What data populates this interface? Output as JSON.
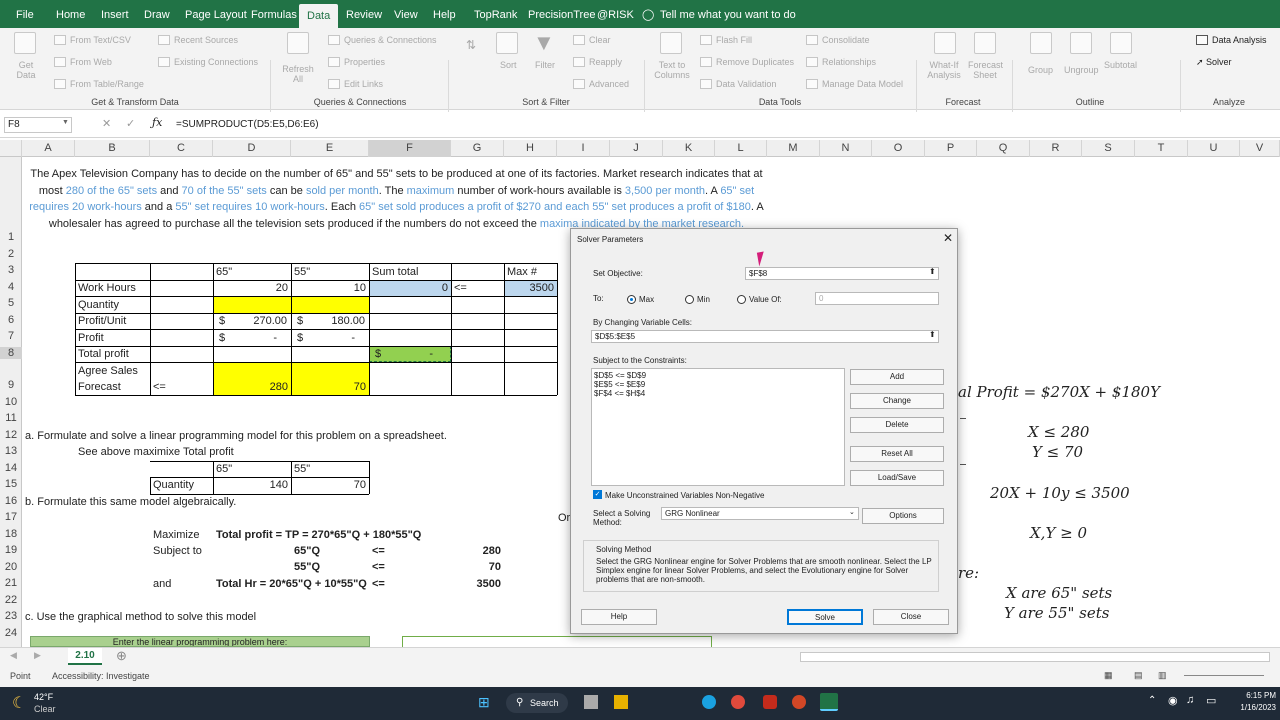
{
  "ribbon": {
    "tabs": [
      "File",
      "Home",
      "Insert",
      "Draw",
      "Page Layout",
      "Formulas",
      "Data",
      "Review",
      "View",
      "Help",
      "TopRank",
      "PrecisionTree",
      "@RISK"
    ],
    "active_tab": "Data",
    "tell_me": "Tell me what you want to do",
    "get_data": "Get Data",
    "get_transform": [
      "From Text/CSV",
      "From Web",
      "From Table/Range",
      "Recent Sources",
      "Existing Connections"
    ],
    "refresh_all": "Refresh All",
    "queries": [
      "Queries & Connections",
      "Properties",
      "Edit Links"
    ],
    "sort_filter": [
      "Sort",
      "Filter",
      "Clear",
      "Reapply",
      "Advanced"
    ],
    "data_tools": [
      "Text to Columns",
      "Flash Fill",
      "Remove Duplicates",
      "Data Validation",
      "Consolidate",
      "Relationships",
      "Manage Data Model"
    ],
    "forecast": [
      "What-If Analysis",
      "Forecast Sheet"
    ],
    "outline": [
      "Group",
      "Ungroup",
      "Subtotal"
    ],
    "analyze": [
      "Data Analysis",
      "Solver"
    ],
    "groups": [
      "Get & Transform Data",
      "Queries & Connections",
      "Sort & Filter",
      "Data Tools",
      "Forecast",
      "Outline",
      "Analyze"
    ]
  },
  "formula_bar": {
    "name_box": "F8",
    "formula": "=SUMPRODUCT(D5:E5,D6:E6)"
  },
  "columns": [
    "A",
    "B",
    "C",
    "D",
    "E",
    "F",
    "G",
    "H",
    "I",
    "J",
    "K",
    "L",
    "M",
    "N",
    "O",
    "P",
    "Q",
    "R",
    "S",
    "T",
    "U",
    "V"
  ],
  "rows": [
    "1",
    "2",
    "3",
    "4",
    "5",
    "6",
    "7",
    "8",
    "9",
    "10",
    "11",
    "12",
    "13",
    "14",
    "15",
    "16",
    "17",
    "18",
    "19",
    "20",
    "21",
    "22",
    "23",
    "24"
  ],
  "problem": {
    "parts": [
      "The Apex Television Company has to decide on the number of 65\" and 55\" sets to be produced at one of its factories. Market research indicates that at most ",
      "280 of the 65\" sets",
      " and ",
      "70 of the 55\" sets",
      " can be ",
      "sold per month",
      ". The ",
      "maximum",
      " number of work-hours available is ",
      "3,500 per month",
      ". A ",
      "65\" set requires 20 work-hours",
      " and a ",
      "55\" set requires 10 work-hours",
      ". Each ",
      "65\" set sold produces a profit of $270 and each 55\" set produces a profit of $180",
      ". A wholesaler has agreed to purchase all the television sets produced if the numbers do not exceed the ",
      "maxima indicated by the market research."
    ]
  },
  "table": {
    "hdr_65": "65\"",
    "hdr_55": "55\"",
    "hdr_sum": "Sum total",
    "hdr_max": "Max #",
    "work_hours": "Work Hours",
    "wh_65": "20",
    "wh_55": "10",
    "wh_sum": "0",
    "le": "<=",
    "wh_max": "3500",
    "quantity": "Quantity",
    "profit_unit": "Profit/Unit",
    "dollar": "$",
    "pu_65": "270.00",
    "pu_55": "180.00",
    "profit": "Profit",
    "dash": "-",
    "total_profit": "Total profit",
    "agree_sales": "Agree Sales",
    "forecast": "Forecast",
    "le2": "<=",
    "f_65": "280",
    "f_55": "70"
  },
  "section_a": {
    "title": "a. Formulate and solve a linear programming model for this problem on a spreadsheet.",
    "see_above": "See above maximixe Total profit",
    "q_hdr_65": "65\"",
    "q_hdr_55": "55\"",
    "q_label": "Quantity",
    "q_65": "140",
    "q_55": "70"
  },
  "section_b": {
    "title": "b. Formulate this same model algebraically.",
    "maximize": "Maximize",
    "objective": "Total profit = TP = 270*65\"Q + 180*55\"Q",
    "subject_to": "Subject to",
    "c1": "65\"Q",
    "c1_op": "<=",
    "c1_v": "280",
    "c2": "55\"Q",
    "c2_op": "<=",
    "c2_v": "70",
    "and": "and",
    "c3": "Total Hr = 20*65\"Q + 10*55\"Q",
    "c3_op": "<=",
    "c3_v": "3500",
    "or_text": "Or"
  },
  "section_c": {
    "title": "c. Use the graphical method to solve this model",
    "box_text": "Enter the linear programming problem here:"
  },
  "math": {
    "objective": "al Profit  =  $270X  +  $180Y",
    "x_le": "X ≤ 280",
    "y_le": "Y ≤ 70",
    "hours": "20X + 10y ≤ 3500",
    "nonneg": "X,Y ≥ 0",
    "where": "re:",
    "x_def": "X are 65\" sets",
    "y_def": "Y are 55\" sets"
  },
  "sheet_tab": "2.10",
  "status": {
    "mode": "Point",
    "accessibility": "Accessibility: Investigate"
  },
  "taskbar": {
    "weather_temp": "42°F",
    "weather_desc": "Clear",
    "search": "Search",
    "time": "6:15 PM",
    "date": "1/16/2023"
  },
  "solver": {
    "title": "Solver Parameters",
    "set_objective_label": "Set Objective:",
    "objective_cell": "$F$8",
    "to_label": "To:",
    "max": "Max",
    "min": "Min",
    "value_of": "Value Of:",
    "value": "0",
    "changing_label": "By Changing Variable Cells:",
    "changing_cells": "$D$5:$E$5",
    "constraints_label": "Subject to the Constraints:",
    "constraints": [
      "$D$5 <= $D$9",
      "$E$5 <= $E$9",
      "$F$4 <= $H$4"
    ],
    "buttons": {
      "add": "Add",
      "change": "Change",
      "delete": "Delete",
      "reset": "Reset All",
      "load": "Load/Save",
      "options": "Options",
      "help": "Help",
      "solve": "Solve",
      "close": "Close"
    },
    "nonneg_label": "Make Unconstrained Variables Non-Negative",
    "method_label": "Select a Solving Method:",
    "method": "GRG Nonlinear",
    "solving_method_title": "Solving Method",
    "solving_method_text": "Select the GRG Nonlinear engine for Solver Problems that are smooth nonlinear. Select the LP Simplex engine for linear Solver Problems, and select the Evolutionary engine for Solver problems that are non-smooth."
  }
}
